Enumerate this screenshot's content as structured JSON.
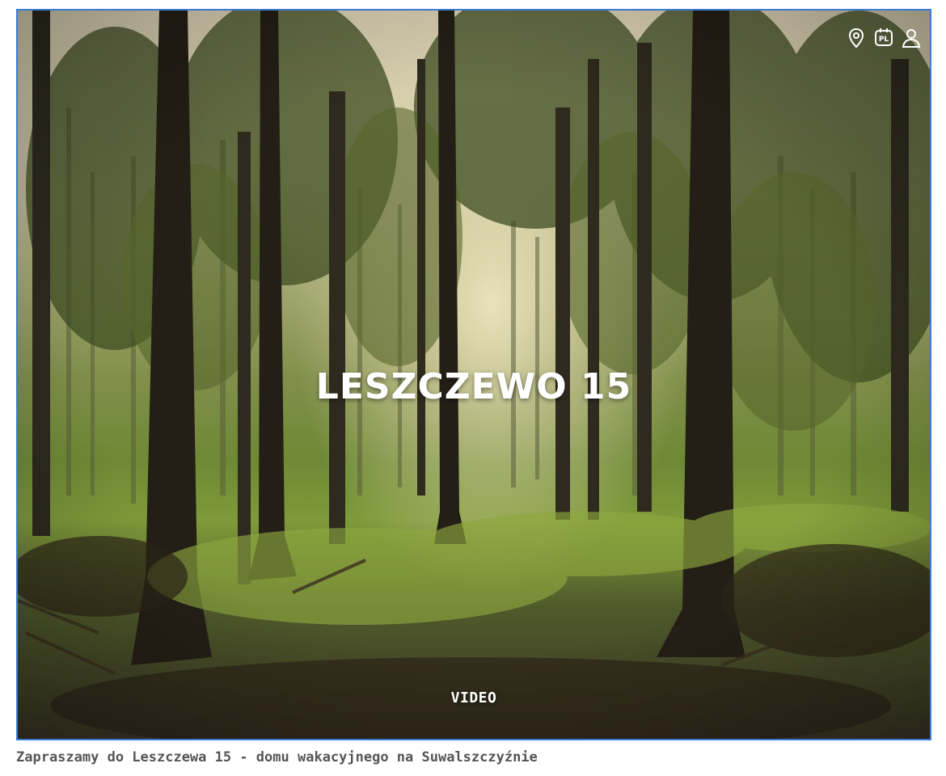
{
  "hero": {
    "title": "LESZCZEWO 15",
    "video_label": "VIDEO"
  },
  "header": {
    "icons": {
      "location": "location-pin-icon",
      "language": "language-icon",
      "account": "user-icon"
    },
    "language_code": "PL"
  },
  "caption": {
    "text": "Zapraszamy do Leszczewa 15 - domu wakacyjnego na Suwalszczyźnie"
  },
  "colors": {
    "frame_border": "#3a7bd5",
    "caption_text": "#555555",
    "overlay_text": "#ffffff"
  }
}
